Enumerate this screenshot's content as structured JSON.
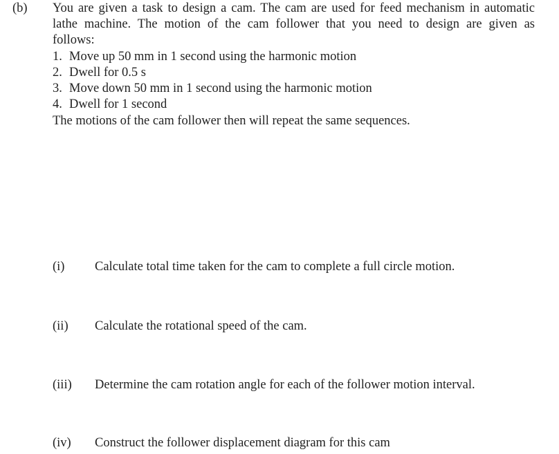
{
  "part_label": "(b)",
  "intro": {
    "line1": "You are given a task to design a cam. The cam are used for feed mechanism in automatic",
    "line2": "lathe machine. The motion of the cam follower that you need to design are given as",
    "line3": "follows:"
  },
  "motions": [
    {
      "num": "1.",
      "text": "Move up 50 mm in 1 second using the harmonic motion"
    },
    {
      "num": "2.",
      "text": "Dwell for 0.5 s"
    },
    {
      "num": "3.",
      "text": "Move down 50 mm in 1 second using the harmonic motion"
    },
    {
      "num": "4.",
      "text": "Dwell for 1 second"
    }
  ],
  "closing": "The motions of the cam follower then will repeat the same sequences.",
  "questions": [
    {
      "label": "(i)",
      "text": "Calculate total time taken for the cam to complete a full circle motion."
    },
    {
      "label": "(ii)",
      "text": "Calculate the rotational speed of the cam."
    },
    {
      "label": "(iii)",
      "text": "Determine the cam rotation angle for each of the follower motion interval."
    },
    {
      "label": "(iv)",
      "text": "Construct the follower displacement diagram for this cam"
    }
  ]
}
